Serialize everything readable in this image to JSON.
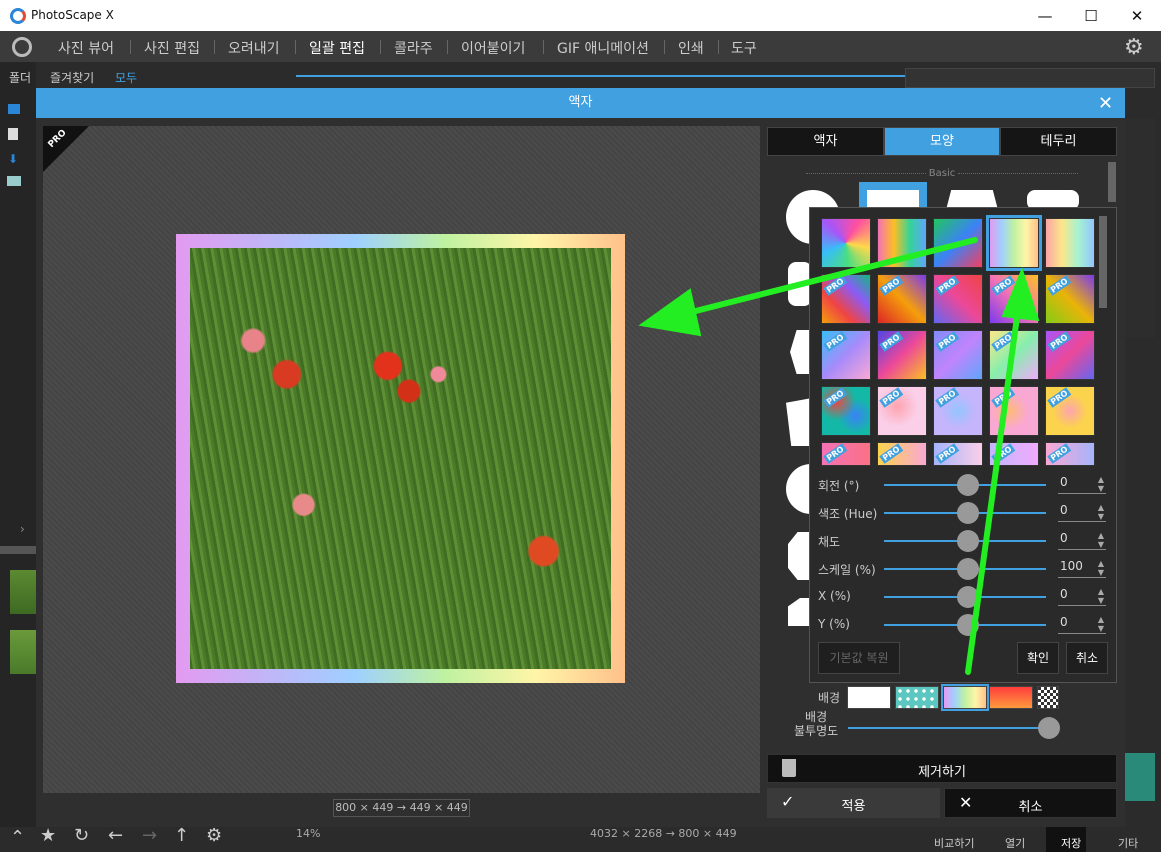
{
  "app": {
    "title": "PhotoScape X"
  },
  "menu": {
    "items": [
      "사진 뷰어",
      "사진 편집",
      "오려내기",
      "일괄 편집",
      "콜라주",
      "이어붙이기",
      "GIF 애니메이션",
      "인쇄",
      "도구"
    ]
  },
  "leftpanel": {
    "tabs": [
      "폴더",
      "즐겨찾기",
      "모두"
    ]
  },
  "dialog": {
    "title": "액자",
    "size_text": "800 × 449 → 449 × 449",
    "pro_badge": "PRO"
  },
  "right_tabs": [
    "액자",
    "모양",
    "테두리"
  ],
  "basic_label": "Basic",
  "sliders": [
    {
      "label": "회전 (°)",
      "value": "0"
    },
    {
      "label": "색조 (Hue)",
      "value": "0"
    },
    {
      "label": "채도",
      "value": "0"
    },
    {
      "label": "스케일 (%)",
      "value": "100"
    },
    {
      "label": "X (%)",
      "value": "0"
    },
    {
      "label": "Y (%)",
      "value": "0"
    }
  ],
  "popup_buttons": {
    "reset": "기본값 복원",
    "ok": "확인",
    "cancel": "취소"
  },
  "background": {
    "label": "배경",
    "opacity_label": "배경\n불투명도"
  },
  "actions": {
    "remove": "제거하기",
    "apply": "적용",
    "cancel": "취소"
  },
  "bottom": {
    "zoom": "14%",
    "size": "4032 × 2268 → 800 × 449",
    "labels": [
      "비교하기",
      "열기",
      "저장",
      "기타"
    ]
  },
  "colors": {
    "accent": "#41a0e0",
    "arrow": "#22ee22"
  }
}
